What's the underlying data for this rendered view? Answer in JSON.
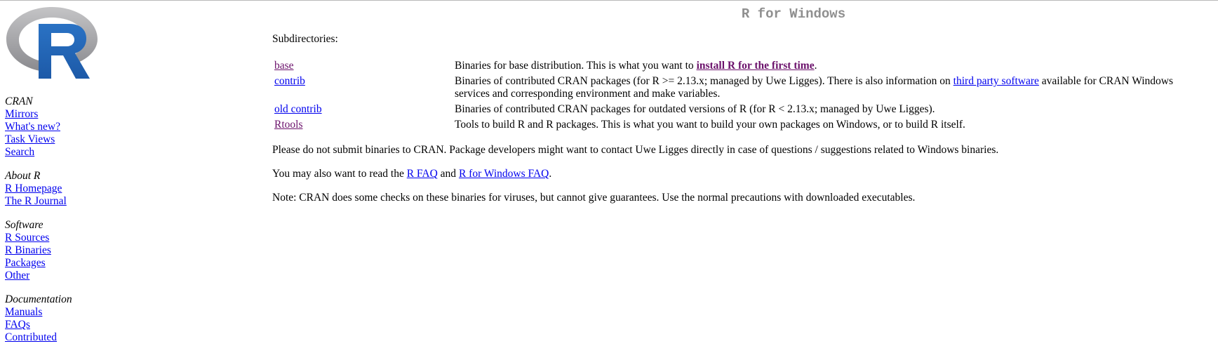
{
  "page": {
    "title": "R for Windows"
  },
  "colors": {
    "link": "#0000ee",
    "visited_link": "#6b116b",
    "title_gray": "#8f8f8f",
    "logo_blue": "#2266b8",
    "logo_gray": "#a3a3a6"
  },
  "sidebar": {
    "logo_icon": "r-logo-icon",
    "sections": [
      {
        "heading": "CRAN",
        "links": [
          "Mirrors",
          "What's new?",
          "Task Views",
          "Search"
        ]
      },
      {
        "heading": "About R",
        "links": [
          "R Homepage",
          "The R Journal"
        ]
      },
      {
        "heading": "Software",
        "links": [
          "R Sources",
          "R Binaries",
          "Packages",
          "Other"
        ]
      },
      {
        "heading": "Documentation",
        "links": [
          "Manuals",
          "FAQs",
          "Contributed"
        ]
      }
    ]
  },
  "main": {
    "subdirectories_heading": "Subdirectories:",
    "rows": [
      {
        "name": "base",
        "desc_before": "Binaries for base distribution. This is what you want to ",
        "desc_link": "install R for the first time",
        "desc_after": "."
      },
      {
        "name": "contrib",
        "desc_before": "Binaries of contributed CRAN packages (for R >= 2.13.x; managed by Uwe Ligges). There is also information on ",
        "desc_link": "third party software",
        "desc_after": " available for CRAN Windows services and corresponding environment and make variables."
      },
      {
        "name": "old contrib",
        "desc": "Binaries of contributed CRAN packages for outdated versions of R (for R < 2.13.x; managed by Uwe Ligges)."
      },
      {
        "name": "Rtools",
        "desc": "Tools to build R and R packages. This is what you want to build your own packages on Windows, or to build R itself."
      }
    ],
    "para_submit": "Please do not submit binaries to CRAN. Package developers might want to contact Uwe Ligges directly in case of questions / suggestions related to Windows binaries.",
    "para_faq": {
      "before": "You may also want to read the ",
      "link1": "R FAQ",
      "middle": " and ",
      "link2": "R for Windows FAQ",
      "after": "."
    },
    "para_note": "Note: CRAN does some checks on these binaries for viruses, but cannot give guarantees. Use the normal precautions with downloaded executables."
  }
}
